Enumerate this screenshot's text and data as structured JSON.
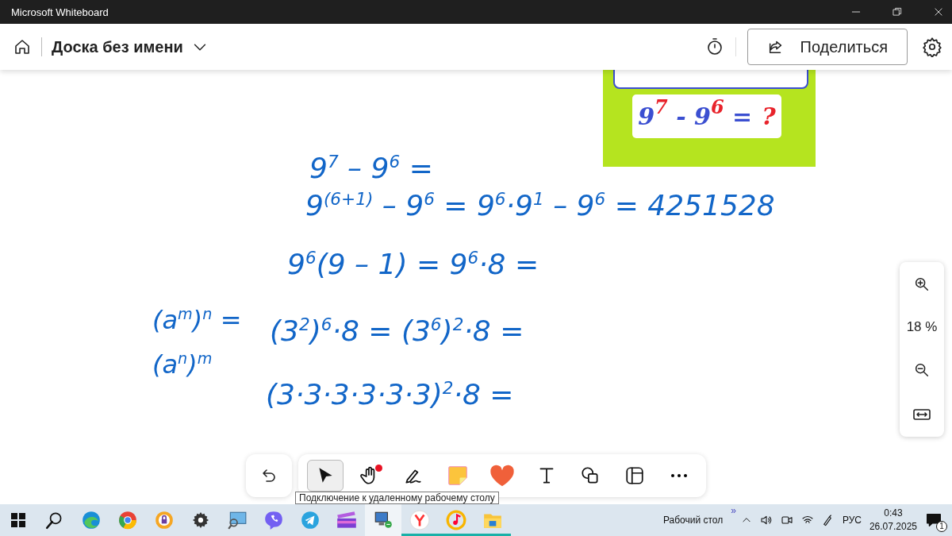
{
  "window": {
    "title": "Microsoft Whiteboard"
  },
  "appbar": {
    "board_name": "Доска без имени",
    "share_button": "Поделиться"
  },
  "task_card": {
    "equation": "9$^{7}$ - 9$^{6}$ =",
    "answer": "?"
  },
  "handwritten_steps": [
    "9$^{7}$ – 9$^{6}$ =",
    "9$^{(6+1)}$ – 9$^{6}$ = 9$^{6}$·9$^{1}$ – 9$^{6}$ = 4251528",
    "9$^{6}$(9 – 1) = 9$^{6}$·8 =",
    "(3$^{2}$)$^{6}$·8 = (3$^{6}$)$^{2}$·8 =",
    "(3·3·3·3·3·3)$^{2}$·8 ="
  ],
  "handwritten_rule": [
    "(a$^{m}$)$^{n}$ =",
    "(a$^{n}$)$^{m}$"
  ],
  "zoom_panel": {
    "level_text": "18 %"
  },
  "toolbar": {
    "tools": [
      {
        "kind": "select",
        "selected": true,
        "dot": false
      },
      {
        "kind": "hand",
        "selected": false,
        "dot": true
      },
      {
        "kind": "pen",
        "selected": false,
        "dot": false
      },
      {
        "kind": "note",
        "selected": false,
        "dot": false
      },
      {
        "kind": "reaction",
        "selected": false,
        "dot": false
      },
      {
        "kind": "text",
        "selected": false,
        "dot": false
      },
      {
        "kind": "shapes",
        "selected": false,
        "dot": false
      },
      {
        "kind": "template",
        "selected": false,
        "dot": false
      },
      {
        "kind": "more",
        "selected": false,
        "dot": false
      }
    ]
  },
  "tooltip": "Подключение к удаленному рабочему столу",
  "taskbar": {
    "apps": [
      {
        "kind": "start",
        "running": false,
        "hovered": false
      },
      {
        "kind": "search",
        "running": false,
        "hovered": false
      },
      {
        "kind": "edge",
        "running": false,
        "hovered": false
      },
      {
        "kind": "chrome",
        "running": false,
        "hovered": false
      },
      {
        "kind": "vpn",
        "running": false,
        "hovered": false
      },
      {
        "kind": "settings",
        "running": false,
        "hovered": false
      },
      {
        "kind": "monitor",
        "running": false,
        "hovered": false
      },
      {
        "kind": "viber",
        "running": false,
        "hovered": false
      },
      {
        "kind": "telegram",
        "running": false,
        "hovered": false
      },
      {
        "kind": "video",
        "running": false,
        "hovered": false
      },
      {
        "kind": "remote",
        "running": false,
        "hovered": true
      },
      {
        "kind": "yandex",
        "running": true,
        "hovered": false
      },
      {
        "kind": "music",
        "running": true,
        "hovered": false
      },
      {
        "kind": "folder",
        "running": true,
        "hovered": false
      }
    ],
    "desktop_label": "Рабочий стол",
    "overflow": "»",
    "language": "РУС",
    "time": "0:43",
    "date": "26.07.2025",
    "notifications": "1"
  }
}
